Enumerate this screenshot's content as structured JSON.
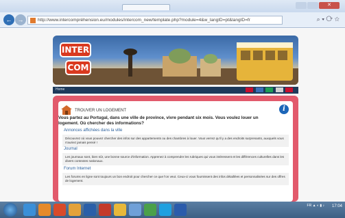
{
  "browser": {
    "url": "http://www.intercompréhension.eu/modules/intercom_new/template.php?module=4&w_langID=pt&langID=fr",
    "tools": "⌕ ▾ ⟳ ☆"
  },
  "site": {
    "logo_top": "INTER",
    "logo_bottom": "COM",
    "home": "Home",
    "flags": [
      "#c8102e",
      "#3a6fb7",
      "#1e9e55",
      "#d1d1d1",
      "#c8102e"
    ]
  },
  "page": {
    "heading": "TROUVER UN LOGEMENT",
    "info": "i",
    "intro": "Vous partez au Portugal, dans une ville de province, vivre pendant six mois. Vous voulez louer un logement. Où chercher des informations?",
    "sections": [
      {
        "title": "Annonces affichées dans la ville",
        "text": "Découvrez où vous pouvez chercher des infos sur des appartements ou des chambres à louer. Vous verrez qu'il y a des endroits surprenants, auxquels vous n'auriez jamais pensé !"
      },
      {
        "title": "Journal",
        "text": "Les journaux sont, bien sûr, une bonne source d'information. Apprenez à comprendre les rubriques qui vous intéressent et les différences culturelles dans les divers contextes nationaux."
      },
      {
        "title": "Forum Internet",
        "text": "Les forums en ligne sont toujours un bon endroit pour chercher ce que l'on veut. Ceux-ci vous fournissent des infos détaillées et personnalisées sur des offres de logement."
      }
    ]
  },
  "taskbar": {
    "tray": "FR ▲ ◐ ▮ ♪",
    "clock": "17:04"
  }
}
